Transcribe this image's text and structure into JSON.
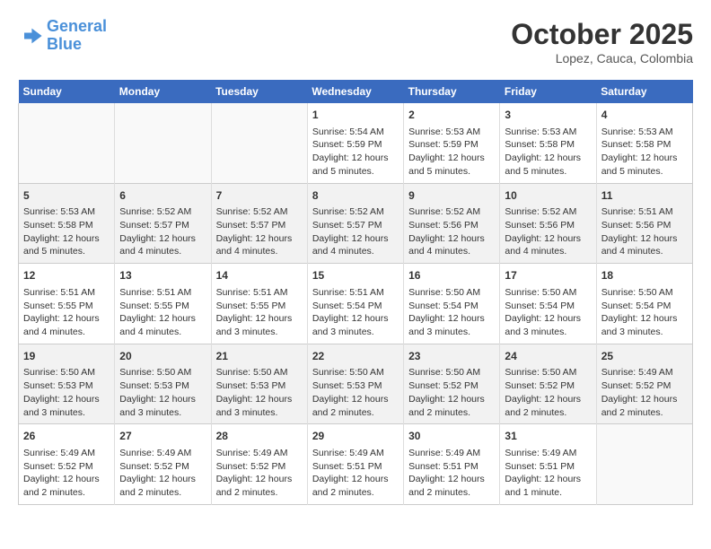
{
  "header": {
    "logo_line1": "General",
    "logo_line2": "Blue",
    "month": "October 2025",
    "location": "Lopez, Cauca, Colombia"
  },
  "weekdays": [
    "Sunday",
    "Monday",
    "Tuesday",
    "Wednesday",
    "Thursday",
    "Friday",
    "Saturday"
  ],
  "weeks": [
    [
      {
        "day": "",
        "info": ""
      },
      {
        "day": "",
        "info": ""
      },
      {
        "day": "",
        "info": ""
      },
      {
        "day": "1",
        "info": "Sunrise: 5:54 AM\nSunset: 5:59 PM\nDaylight: 12 hours\nand 5 minutes."
      },
      {
        "day": "2",
        "info": "Sunrise: 5:53 AM\nSunset: 5:59 PM\nDaylight: 12 hours\nand 5 minutes."
      },
      {
        "day": "3",
        "info": "Sunrise: 5:53 AM\nSunset: 5:58 PM\nDaylight: 12 hours\nand 5 minutes."
      },
      {
        "day": "4",
        "info": "Sunrise: 5:53 AM\nSunset: 5:58 PM\nDaylight: 12 hours\nand 5 minutes."
      }
    ],
    [
      {
        "day": "5",
        "info": "Sunrise: 5:53 AM\nSunset: 5:58 PM\nDaylight: 12 hours\nand 5 minutes."
      },
      {
        "day": "6",
        "info": "Sunrise: 5:52 AM\nSunset: 5:57 PM\nDaylight: 12 hours\nand 4 minutes."
      },
      {
        "day": "7",
        "info": "Sunrise: 5:52 AM\nSunset: 5:57 PM\nDaylight: 12 hours\nand 4 minutes."
      },
      {
        "day": "8",
        "info": "Sunrise: 5:52 AM\nSunset: 5:57 PM\nDaylight: 12 hours\nand 4 minutes."
      },
      {
        "day": "9",
        "info": "Sunrise: 5:52 AM\nSunset: 5:56 PM\nDaylight: 12 hours\nand 4 minutes."
      },
      {
        "day": "10",
        "info": "Sunrise: 5:52 AM\nSunset: 5:56 PM\nDaylight: 12 hours\nand 4 minutes."
      },
      {
        "day": "11",
        "info": "Sunrise: 5:51 AM\nSunset: 5:56 PM\nDaylight: 12 hours\nand 4 minutes."
      }
    ],
    [
      {
        "day": "12",
        "info": "Sunrise: 5:51 AM\nSunset: 5:55 PM\nDaylight: 12 hours\nand 4 minutes."
      },
      {
        "day": "13",
        "info": "Sunrise: 5:51 AM\nSunset: 5:55 PM\nDaylight: 12 hours\nand 4 minutes."
      },
      {
        "day": "14",
        "info": "Sunrise: 5:51 AM\nSunset: 5:55 PM\nDaylight: 12 hours\nand 3 minutes."
      },
      {
        "day": "15",
        "info": "Sunrise: 5:51 AM\nSunset: 5:54 PM\nDaylight: 12 hours\nand 3 minutes."
      },
      {
        "day": "16",
        "info": "Sunrise: 5:50 AM\nSunset: 5:54 PM\nDaylight: 12 hours\nand 3 minutes."
      },
      {
        "day": "17",
        "info": "Sunrise: 5:50 AM\nSunset: 5:54 PM\nDaylight: 12 hours\nand 3 minutes."
      },
      {
        "day": "18",
        "info": "Sunrise: 5:50 AM\nSunset: 5:54 PM\nDaylight: 12 hours\nand 3 minutes."
      }
    ],
    [
      {
        "day": "19",
        "info": "Sunrise: 5:50 AM\nSunset: 5:53 PM\nDaylight: 12 hours\nand 3 minutes."
      },
      {
        "day": "20",
        "info": "Sunrise: 5:50 AM\nSunset: 5:53 PM\nDaylight: 12 hours\nand 3 minutes."
      },
      {
        "day": "21",
        "info": "Sunrise: 5:50 AM\nSunset: 5:53 PM\nDaylight: 12 hours\nand 3 minutes."
      },
      {
        "day": "22",
        "info": "Sunrise: 5:50 AM\nSunset: 5:53 PM\nDaylight: 12 hours\nand 2 minutes."
      },
      {
        "day": "23",
        "info": "Sunrise: 5:50 AM\nSunset: 5:52 PM\nDaylight: 12 hours\nand 2 minutes."
      },
      {
        "day": "24",
        "info": "Sunrise: 5:50 AM\nSunset: 5:52 PM\nDaylight: 12 hours\nand 2 minutes."
      },
      {
        "day": "25",
        "info": "Sunrise: 5:49 AM\nSunset: 5:52 PM\nDaylight: 12 hours\nand 2 minutes."
      }
    ],
    [
      {
        "day": "26",
        "info": "Sunrise: 5:49 AM\nSunset: 5:52 PM\nDaylight: 12 hours\nand 2 minutes."
      },
      {
        "day": "27",
        "info": "Sunrise: 5:49 AM\nSunset: 5:52 PM\nDaylight: 12 hours\nand 2 minutes."
      },
      {
        "day": "28",
        "info": "Sunrise: 5:49 AM\nSunset: 5:52 PM\nDaylight: 12 hours\nand 2 minutes."
      },
      {
        "day": "29",
        "info": "Sunrise: 5:49 AM\nSunset: 5:51 PM\nDaylight: 12 hours\nand 2 minutes."
      },
      {
        "day": "30",
        "info": "Sunrise: 5:49 AM\nSunset: 5:51 PM\nDaylight: 12 hours\nand 2 minutes."
      },
      {
        "day": "31",
        "info": "Sunrise: 5:49 AM\nSunset: 5:51 PM\nDaylight: 12 hours\nand 1 minute."
      },
      {
        "day": "",
        "info": ""
      }
    ]
  ]
}
